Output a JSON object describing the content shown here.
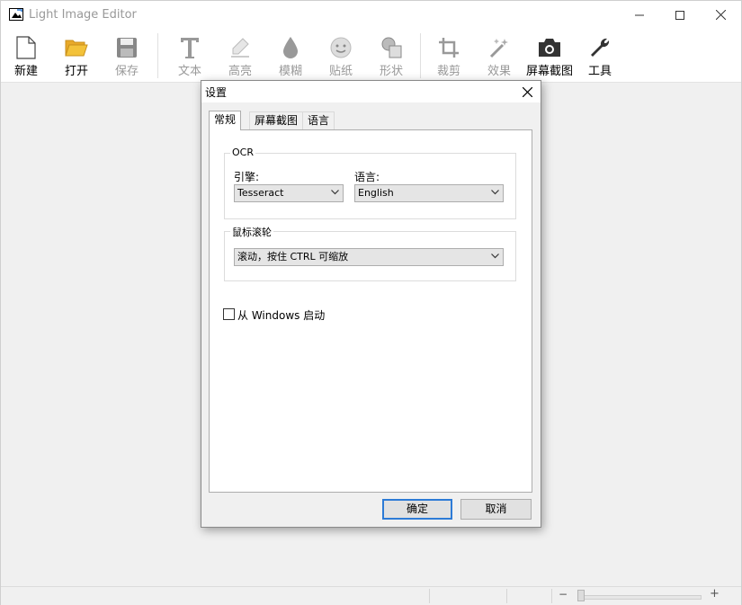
{
  "window": {
    "title": "Light Image Editor"
  },
  "toolbar": {
    "new_label": "新建",
    "open_label": "打开",
    "save_label": "保存",
    "text_label": "文本",
    "highlight_label": "高亮",
    "blur_label": "模糊",
    "sticker_label": "贴纸",
    "shape_label": "形状",
    "crop_label": "裁剪",
    "effects_label": "效果",
    "screenshot_label": "屏幕截图",
    "tools_label": "工具"
  },
  "dialog": {
    "title": "设置",
    "tabs": [
      "常规",
      "屏幕截图",
      "语言"
    ],
    "ocr": {
      "group_title": "OCR",
      "engine_label": "引擎:",
      "engine_value": "Tesseract",
      "language_label": "语言:",
      "language_value": "English"
    },
    "mouse_wheel": {
      "group_title": "鼠标滚轮",
      "value": "滚动，按住 CTRL 可缩放"
    },
    "startup_checkbox_label": "从 Windows 启动",
    "startup_checked": false,
    "ok_label": "确定",
    "cancel_label": "取消"
  },
  "statusbar": {
    "zoom_minus": "−",
    "zoom_plus": "+"
  },
  "colors": {
    "accent": "#2d7bd6",
    "folder": "#f3c23a",
    "disabled": "#999999"
  }
}
